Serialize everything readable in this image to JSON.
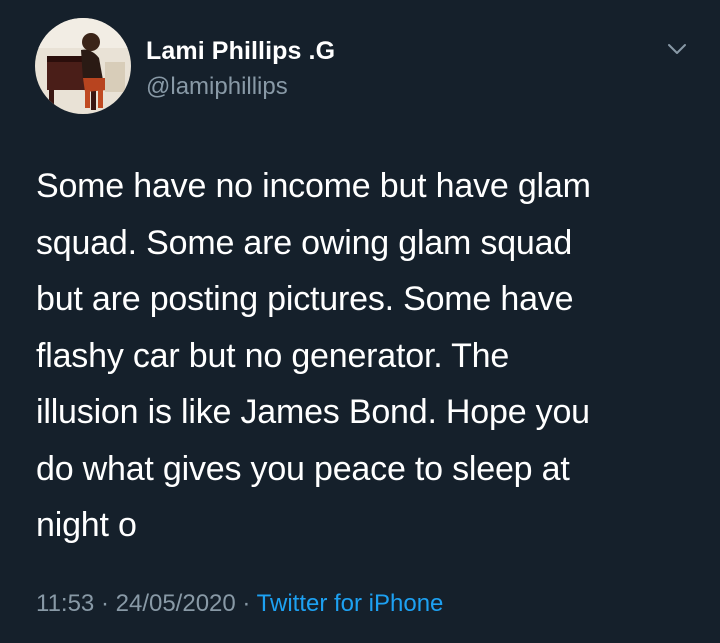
{
  "tweet": {
    "display_name": "Lami Phillips .G",
    "handle": "@lamiphillips",
    "text": "Some have no income but have glam\nsquad. Some are owing glam squad\nbut are posting pictures. Some have\nflashy car but no generator. The\nillusion is like James Bond. Hope you\ndo what gives you peace to sleep at\nnight o",
    "time": "11:53",
    "separator": "·",
    "date": "24/05/2020",
    "source": "Twitter for iPhone"
  },
  "icons": {
    "menu": "chevron-down-icon",
    "avatar": "profile-photo"
  },
  "colors": {
    "background": "#15202b",
    "text_primary": "#ffffff",
    "text_secondary": "#8899a6",
    "link": "#1da1f2"
  }
}
